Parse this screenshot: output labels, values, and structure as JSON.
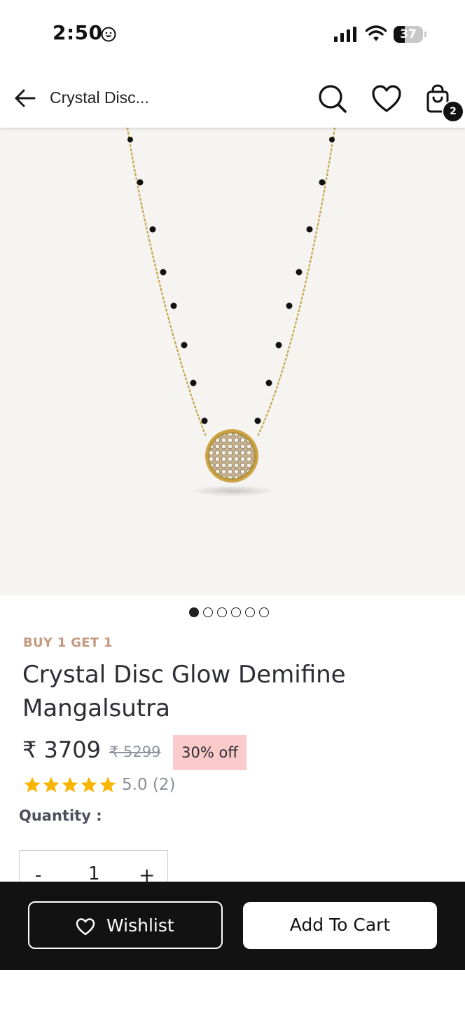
{
  "status_bar": {
    "time": "2:50",
    "battery": "37"
  },
  "header": {
    "title": "Crystal Disc...",
    "cart_count": "2"
  },
  "carousel": {
    "total": 6,
    "active": 0
  },
  "product": {
    "offer": "BUY 1 GET 1",
    "title": "Crystal Disc Glow Demifine Mangalsutra",
    "price": "₹ 3709",
    "mrp": "₹ 5299",
    "discount": "30% off",
    "stars": 5,
    "rating": "5.0 (2)"
  },
  "quantity": {
    "label": "Quantity :",
    "minus": "-",
    "value": "1",
    "plus": "+"
  },
  "actions": {
    "wishlist": "Wishlist",
    "add_to_cart": "Add To Cart"
  },
  "colors": {
    "accent_offer": "#c39a7f",
    "discount_bg": "#fbcaca",
    "star": "#f7b500",
    "bottom_bar": "#121212"
  }
}
